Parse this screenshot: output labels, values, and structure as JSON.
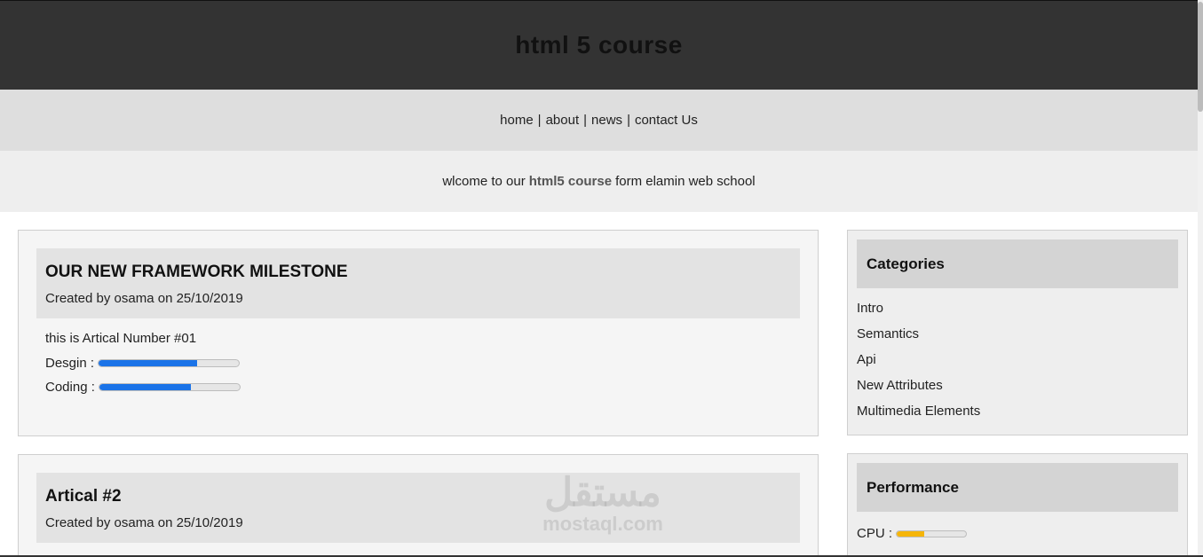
{
  "header": {
    "title": "html 5 course"
  },
  "nav": {
    "items": [
      {
        "label": "home"
      },
      {
        "label": "about"
      },
      {
        "label": "news"
      },
      {
        "label": "contact Us"
      }
    ],
    "separator": "|"
  },
  "welcome": {
    "before": "wlcome to our",
    "highlight": "html5 course",
    "after": "form elamin web school"
  },
  "articles": [
    {
      "title": "OUR NEW FRAMEWORK MILESTONE",
      "meta": "Created by osama on 25/10/2019",
      "text": "this is Artical Number #01",
      "skills": [
        {
          "label": "Desgin :",
          "percent": 70
        },
        {
          "label": "Coding :",
          "percent": 65
        }
      ]
    },
    {
      "title": "Artical #2",
      "meta": "Created by osama on 25/10/2019"
    }
  ],
  "categories": {
    "title": "Categories",
    "items": [
      "Intro",
      "Semantics",
      "Api",
      "New Attributes",
      "Multimedia Elements"
    ]
  },
  "performance": {
    "title": "Performance",
    "cpu": {
      "label": "CPU :",
      "percent": 40,
      "color": "#f5b50a"
    }
  },
  "watermark": {
    "arabic": "مستقل",
    "latin": "mostaql.com"
  },
  "colors": {
    "header_bg": "#333333",
    "nav_bg": "#dedede",
    "welcome_bg": "#eeeeee",
    "progress_blue": "#1a73e8"
  }
}
